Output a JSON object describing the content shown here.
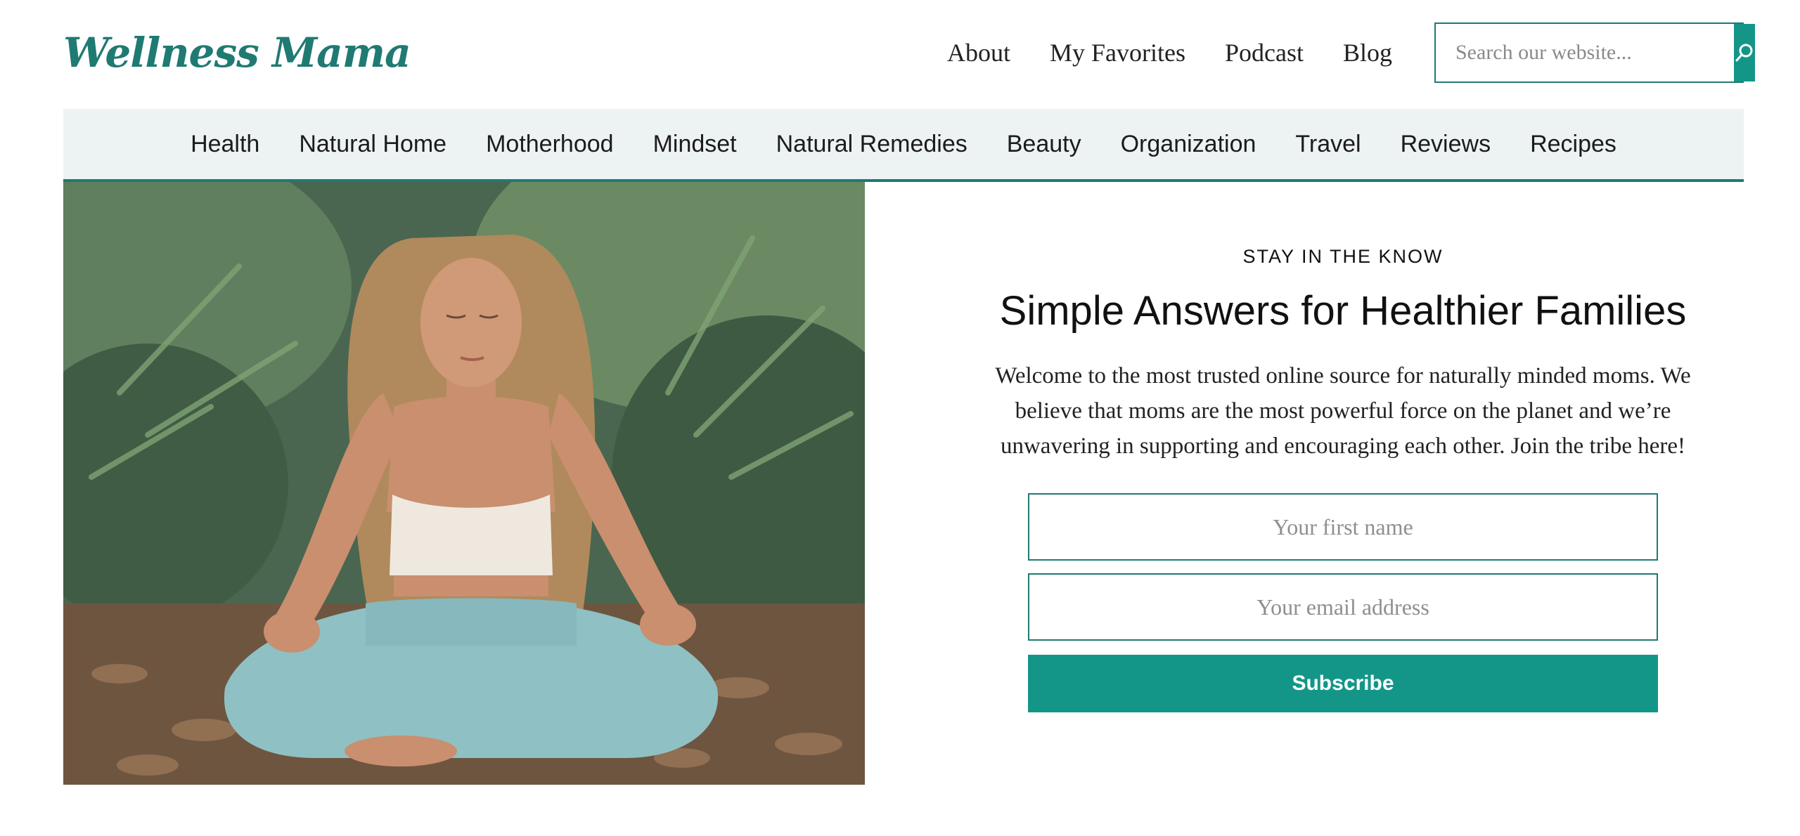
{
  "brand": {
    "logo_text": "Wellness Mama",
    "accent": "#1f7a72",
    "button": "#139688",
    "nav_bg": "#ecf3f2"
  },
  "top_nav": [
    {
      "label": "About"
    },
    {
      "label": "My Favorites"
    },
    {
      "label": "Podcast"
    },
    {
      "label": "Blog"
    }
  ],
  "search": {
    "placeholder": "Search our website...",
    "icon": "search-icon"
  },
  "categories": [
    {
      "label": "Health"
    },
    {
      "label": "Natural Home"
    },
    {
      "label": "Motherhood"
    },
    {
      "label": "Mindset"
    },
    {
      "label": "Natural Remedies"
    },
    {
      "label": "Beauty"
    },
    {
      "label": "Organization"
    },
    {
      "label": "Travel"
    },
    {
      "label": "Reviews"
    },
    {
      "label": "Recipes"
    }
  ],
  "signup": {
    "eyebrow": "STAY IN THE KNOW",
    "headline": "Simple Answers for Healthier Families",
    "intro": "Welcome to the most trusted online source for naturally minded moms. We believe that moms are the most powerful force on the planet and we’re unwavering in supporting and encouraging each other. Join the tribe here!",
    "first_name_placeholder": "Your first name",
    "email_placeholder": "Your email address",
    "button_label": "Subscribe"
  }
}
